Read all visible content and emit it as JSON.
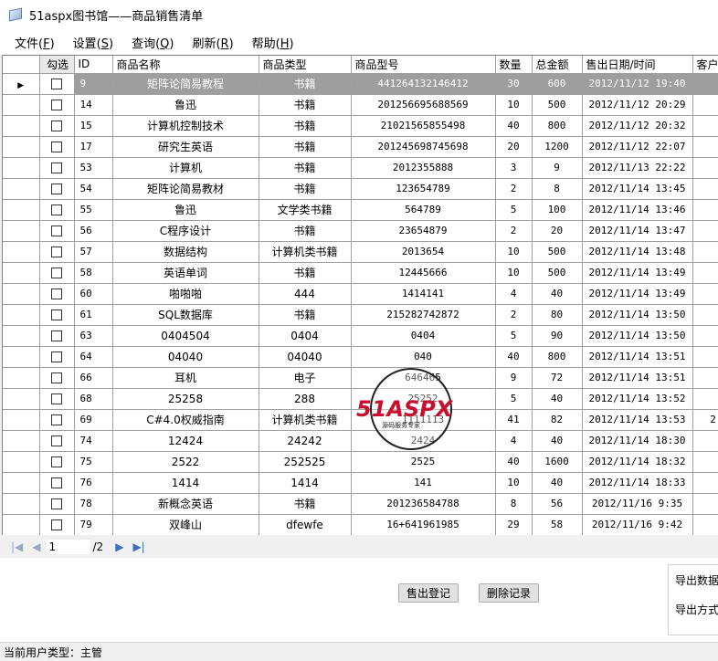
{
  "window": {
    "title": "51aspx图书馆——商品销售清单"
  },
  "menu": [
    {
      "label": "文件(",
      "key": "F",
      "end": ")"
    },
    {
      "label": "设置(",
      "key": "S",
      "end": ")"
    },
    {
      "label": "查询(",
      "key": "Q",
      "end": ")"
    },
    {
      "label": "刷新(",
      "key": "R",
      "end": ")"
    },
    {
      "label": "帮助(",
      "key": "H",
      "end": ")"
    }
  ],
  "grid": {
    "columns": [
      "勾选",
      "ID",
      "商品名称",
      "商品类型",
      "商品型号",
      "数量",
      "总金额",
      "售出日期/时间",
      "客户"
    ],
    "rows": [
      {
        "id": "9",
        "name": "矩阵论简易教程",
        "type": "书籍",
        "model": "441264132146412",
        "qty": "30",
        "total": "600",
        "date": "2012/11/12 19:40",
        "extra": ""
      },
      {
        "id": "14",
        "name": "鲁迅",
        "type": "书籍",
        "model": "201256695688569",
        "qty": "10",
        "total": "500",
        "date": "2012/11/12 20:29",
        "extra": ""
      },
      {
        "id": "15",
        "name": "计算机控制技术",
        "type": "书籍",
        "model": "21021565855498",
        "qty": "40",
        "total": "800",
        "date": "2012/11/12 20:32",
        "extra": ""
      },
      {
        "id": "17",
        "name": "研究生英语",
        "type": "书籍",
        "model": "201245698745698",
        "qty": "20",
        "total": "1200",
        "date": "2012/11/12 22:07",
        "extra": ""
      },
      {
        "id": "53",
        "name": "计算机",
        "type": "书籍",
        "model": "2012355888",
        "qty": "3",
        "total": "9",
        "date": "2012/11/13 22:22",
        "extra": ""
      },
      {
        "id": "54",
        "name": "矩阵论简易教材",
        "type": "书籍",
        "model": "123654789",
        "qty": "2",
        "total": "8",
        "date": "2012/11/14 13:45",
        "extra": ""
      },
      {
        "id": "55",
        "name": "鲁迅",
        "type": "文学类书籍",
        "model": "564789",
        "qty": "5",
        "total": "100",
        "date": "2012/11/14 13:46",
        "extra": ""
      },
      {
        "id": "56",
        "name": "C程序设计",
        "type": "书籍",
        "model": "23654879",
        "qty": "2",
        "total": "20",
        "date": "2012/11/14 13:47",
        "extra": ""
      },
      {
        "id": "57",
        "name": "数据结构",
        "type": "计算机类书籍",
        "model": "2013654",
        "qty": "10",
        "total": "500",
        "date": "2012/11/14 13:48",
        "extra": ""
      },
      {
        "id": "58",
        "name": "英语单词",
        "type": "书籍",
        "model": "12445666",
        "qty": "10",
        "total": "500",
        "date": "2012/11/14 13:49",
        "extra": ""
      },
      {
        "id": "60",
        "name": "啪啪啪",
        "type": "444",
        "model": "1414141",
        "qty": "4",
        "total": "40",
        "date": "2012/11/14 13:49",
        "extra": ""
      },
      {
        "id": "61",
        "name": "SQL数据库",
        "type": "书籍",
        "model": "215282742872",
        "qty": "2",
        "total": "80",
        "date": "2012/11/14 13:50",
        "extra": ""
      },
      {
        "id": "63",
        "name": "0404504",
        "type": "0404",
        "model": "0404",
        "qty": "5",
        "total": "90",
        "date": "2012/11/14 13:50",
        "extra": ""
      },
      {
        "id": "64",
        "name": "04040",
        "type": "04040",
        "model": "040",
        "qty": "40",
        "total": "800",
        "date": "2012/11/14 13:51",
        "extra": ""
      },
      {
        "id": "66",
        "name": "耳机",
        "type": "电子",
        "model": "646465",
        "qty": "9",
        "total": "72",
        "date": "2012/11/14 13:51",
        "extra": ""
      },
      {
        "id": "68",
        "name": "25258",
        "type": "288",
        "model": "25252",
        "qty": "5",
        "total": "40",
        "date": "2012/11/14 13:52",
        "extra": ""
      },
      {
        "id": "69",
        "name": "C#4.0权威指南",
        "type": "计算机类书籍",
        "model": "1111113",
        "qty": "41",
        "total": "82",
        "date": "2012/11/14 13:53",
        "extra": "2"
      },
      {
        "id": "74",
        "name": "12424",
        "type": "24242",
        "model": "2424",
        "qty": "4",
        "total": "40",
        "date": "2012/11/14 18:30",
        "extra": ""
      },
      {
        "id": "75",
        "name": "2522",
        "type": "252525",
        "model": "2525",
        "qty": "40",
        "total": "1600",
        "date": "2012/11/14 18:32",
        "extra": ""
      },
      {
        "id": "76",
        "name": "1414",
        "type": "1414",
        "model": "141",
        "qty": "10",
        "total": "40",
        "date": "2012/11/14 18:33",
        "extra": ""
      },
      {
        "id": "78",
        "name": "新概念英语",
        "type": "书籍",
        "model": "201236584788",
        "qty": "8",
        "total": "56",
        "date": "2012/11/16 9:35",
        "extra": ""
      },
      {
        "id": "79",
        "name": "双峰山",
        "type": "dfewfe",
        "model": "16+641961985",
        "qty": "29",
        "total": "58",
        "date": "2012/11/16 9:42",
        "extra": ""
      }
    ]
  },
  "pager": {
    "page": "1",
    "total": "/2"
  },
  "actions": {
    "sell_label": "售出登记",
    "delete_label": "删除记录"
  },
  "export": {
    "data_label": "导出数据",
    "mode_label": "导出方式"
  },
  "watermark": {
    "brand": "51ASPX",
    "tagline": "源码服务专家"
  },
  "status": {
    "text": "当前用户类型：主管"
  }
}
